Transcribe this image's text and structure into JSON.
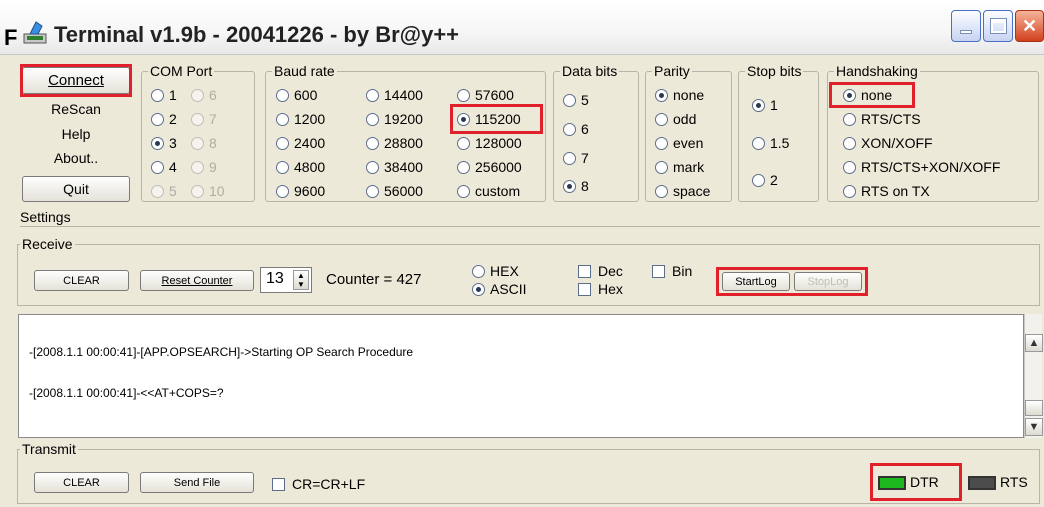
{
  "window": {
    "prefix": "F",
    "title": "Terminal v1.9b - 20041226 - by Br@y++"
  },
  "buttons": {
    "connect": "Connect",
    "rescan": "ReScan",
    "help": "Help",
    "about": "About..",
    "quit": "Quit"
  },
  "com_port": {
    "label": "COM Port",
    "options": [
      "1",
      "2",
      "3",
      "4",
      "5",
      "6",
      "7",
      "8",
      "9",
      "10"
    ],
    "selected": "3"
  },
  "baud_rate": {
    "label": "Baud rate",
    "options": [
      "600",
      "1200",
      "2400",
      "4800",
      "9600",
      "14400",
      "19200",
      "28800",
      "38400",
      "56000",
      "57600",
      "115200",
      "128000",
      "256000",
      "custom"
    ],
    "selected": "115200"
  },
  "data_bits": {
    "label": "Data bits",
    "options": [
      "5",
      "6",
      "7",
      "8"
    ],
    "selected": "8"
  },
  "parity": {
    "label": "Parity",
    "options": [
      "none",
      "odd",
      "even",
      "mark",
      "space"
    ],
    "selected": "none"
  },
  "stop_bits": {
    "label": "Stop bits",
    "options": [
      "1",
      "1.5",
      "2"
    ],
    "selected": "1"
  },
  "handshaking": {
    "label": "Handshaking",
    "options": [
      "none",
      "RTS/CTS",
      "XON/XOFF",
      "RTS/CTS+XON/XOFF",
      "RTS on TX"
    ],
    "selected": "none"
  },
  "settings": {
    "label": "Settings"
  },
  "receive": {
    "label": "Receive",
    "clear": "CLEAR",
    "reset_counter": "Reset Counter",
    "counter_value": "13",
    "counter_text": "Counter = 427",
    "hex": "HEX",
    "ascii": "ASCII",
    "selected_mode": "ASCII",
    "dec": "Dec",
    "hex_chk": "Hex",
    "bin": "Bin",
    "startlog": "StartLog",
    "stoplog": "StopLog"
  },
  "log": {
    "lines": [
      "-[2008.1.1 00:00:41]-[APP.OPSEARCH]->Starting OP Search Procedure",
      "-[2008.1.1 00:00:41]-<<AT+COPS=?"
    ]
  },
  "transmit": {
    "label": "Transmit",
    "clear": "CLEAR",
    "send_file": "Send File",
    "crlf": "CR=CR+LF",
    "dtr": "DTR",
    "rts": "RTS"
  },
  "colors": {
    "highlight": "#e0202a",
    "dtr_led": "#1db81d",
    "rts_led": "#4c4c4c"
  }
}
